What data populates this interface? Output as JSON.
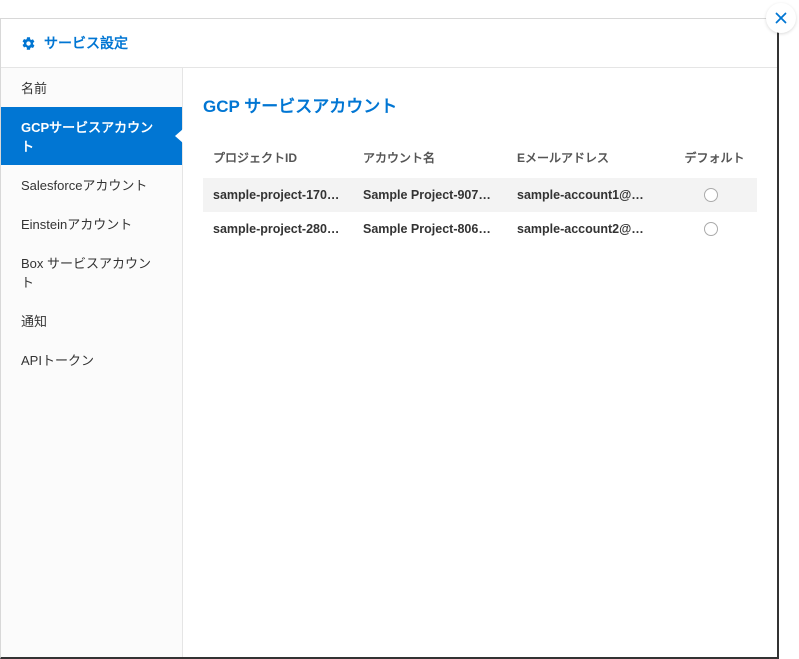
{
  "header": {
    "title": "サービス設定"
  },
  "sidebar": {
    "items": [
      {
        "label": "名前",
        "id": "name"
      },
      {
        "label": "GCPサービスアカウント",
        "id": "gcp"
      },
      {
        "label": "Salesforceアカウント",
        "id": "salesforce"
      },
      {
        "label": "Einsteinアカウント",
        "id": "einstein"
      },
      {
        "label": "Box サービスアカウント",
        "id": "box"
      },
      {
        "label": "通知",
        "id": "notifications"
      },
      {
        "label": "APIトークン",
        "id": "api-token"
      }
    ]
  },
  "main": {
    "title": "GCP サービスアカウント",
    "columns": {
      "project_id": "プロジェクトID",
      "account_name": "アカウント名",
      "email": "Eメールアドレス",
      "default": "デフォルト"
    },
    "rows": [
      {
        "project_id": "sample-project-170…",
        "account_name": "Sample Project-907…",
        "email": "sample-account1@…",
        "default": false
      },
      {
        "project_id": "sample-project-280…",
        "account_name": "Sample Project-806…",
        "email": "sample-account2@…",
        "default": false
      }
    ]
  }
}
